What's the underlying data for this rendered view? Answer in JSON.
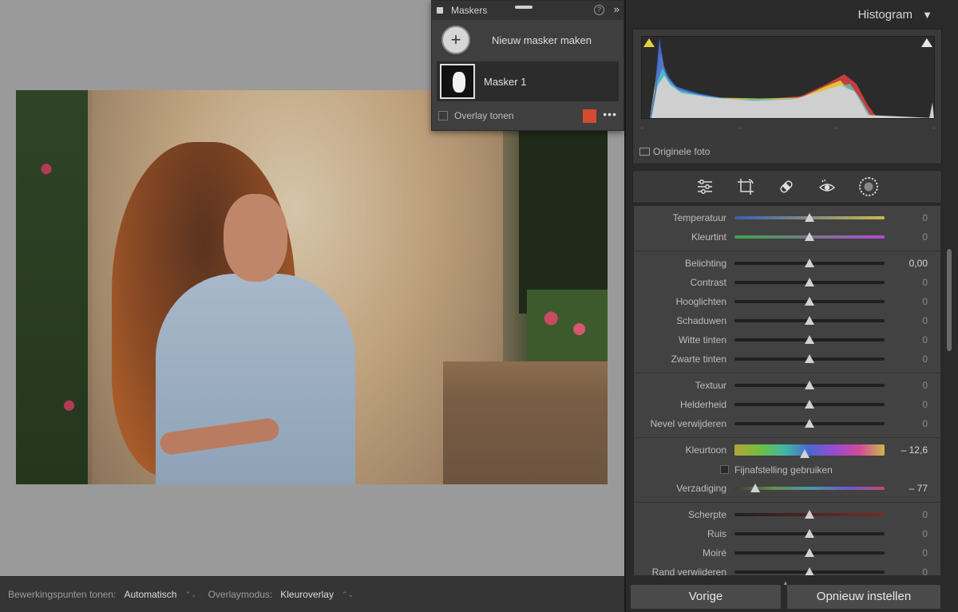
{
  "masks_panel": {
    "title": "Maskers",
    "help_icon": "?",
    "collapse_icon": "»",
    "new_mask_label": "Nieuw masker maken",
    "mask_item_label": "Masker 1",
    "overlay_label": "Overlay tonen",
    "overlay_color": "#d64a30",
    "more_icon": "•••"
  },
  "histogram": {
    "title": "Histogram",
    "title_arrow": "▼",
    "original_photo_label": "Originele foto"
  },
  "tools": {
    "icons": [
      "sliders-icon",
      "crop-icon",
      "healing-icon",
      "red-eye-icon",
      "masking-icon"
    ]
  },
  "adjustments": {
    "groups": [
      [
        {
          "label": "Temperatuur",
          "value": "0",
          "pos": 0.5,
          "track": "linear-gradient(90deg,#3b5fb5,#c9b84a)"
        },
        {
          "label": "Kleurtint",
          "value": "0",
          "pos": 0.5,
          "track": "linear-gradient(90deg,#3aa54a,#b34ad0)"
        }
      ],
      [
        {
          "label": "Belichting",
          "value": "0,00",
          "pos": 0.5,
          "track": "#202020"
        },
        {
          "label": "Contrast",
          "value": "0",
          "pos": 0.5,
          "track": "#202020"
        },
        {
          "label": "Hooglichten",
          "value": "0",
          "pos": 0.5,
          "track": "#202020"
        },
        {
          "label": "Schaduwen",
          "value": "0",
          "pos": 0.5,
          "track": "#202020"
        },
        {
          "label": "Witte tinten",
          "value": "0",
          "pos": 0.5,
          "track": "#202020"
        },
        {
          "label": "Zwarte tinten",
          "value": "0",
          "pos": 0.5,
          "track": "#202020"
        }
      ],
      [
        {
          "label": "Textuur",
          "value": "0",
          "pos": 0.5,
          "track": "#202020"
        },
        {
          "label": "Helderheid",
          "value": "0",
          "pos": 0.5,
          "track": "#202020"
        },
        {
          "label": "Nevel verwijderen",
          "value": "0",
          "pos": 0.5,
          "track": "#202020"
        }
      ]
    ],
    "hue": {
      "label": "Kleurtoon",
      "value": "– 12,6",
      "pos": 0.47
    },
    "fine_tune_label": "Fijnafstelling gebruiken",
    "saturation": {
      "label": "Verzadiging",
      "value": "– 77",
      "pos": 0.14
    },
    "detail_group": [
      {
        "label": "Scherpte",
        "value": "0",
        "pos": 0.5,
        "track": "linear-gradient(90deg,#202020,#7a2a2a)"
      },
      {
        "label": "Ruis",
        "value": "0",
        "pos": 0.5,
        "track": "#202020"
      },
      {
        "label": "Moiré",
        "value": "0",
        "pos": 0.5,
        "track": "#202020"
      },
      {
        "label": "Rand verwijderen",
        "value": "0",
        "pos": 0.5,
        "track": "#202020"
      }
    ]
  },
  "statusbar": {
    "edit_points_label": "Bewerkingspunten tonen:",
    "edit_points_value": "Automatisch",
    "overlay_mode_label": "Overlaymodus:",
    "overlay_mode_value": "Kleuroverlay",
    "chevron": "⌃⌄"
  },
  "buttons": {
    "previous": "Vorige",
    "reset": "Opnieuw instellen"
  }
}
